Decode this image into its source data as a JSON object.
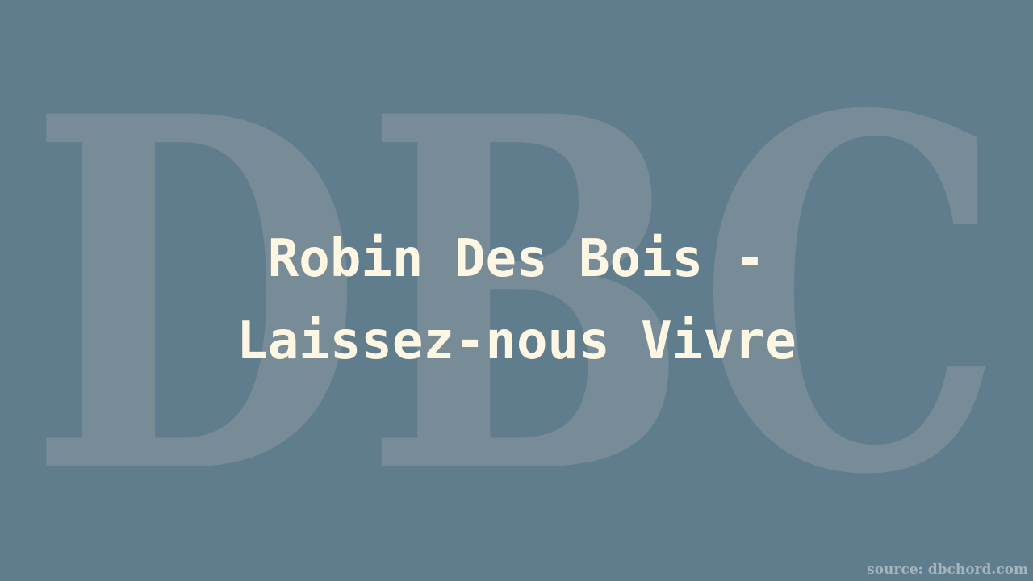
{
  "colors": {
    "background": "#607d8d",
    "watermark": "#788c98",
    "title": "#fdf6e3",
    "source": "#a5b4bd"
  },
  "watermark": {
    "text": "DBC"
  },
  "title": {
    "line1": "Robin Des Bois -",
    "line2": "Laissez-nous Vivre"
  },
  "source": {
    "text": "source: dbchord.com"
  }
}
